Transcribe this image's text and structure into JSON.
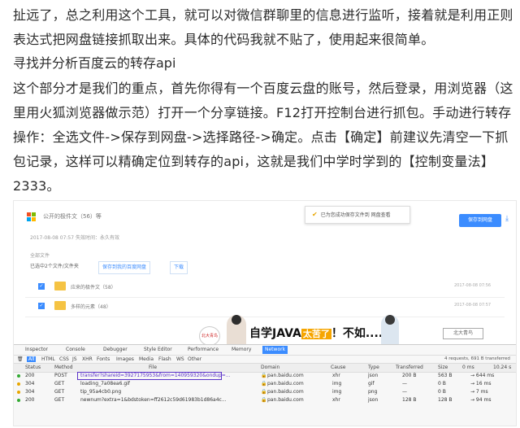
{
  "article": {
    "para1_line1": "扯远了，总之利用这个工具，就可以对微信群聊里的信息进行监听，接着就是利用正则",
    "para1_line2": "表达式把网盘链接抓取出来。具体的代码我就不贴了，使用起来很简单。",
    "heading": "寻找并分析百度云的转存api",
    "para2_line1": "这个部分才是我们的重点，首先你得有一个百度云盘的账号，然后登录，用浏览器（这",
    "para2_line2": "里用火狐浏览器做示范）打开一个分享链接。F12打开控制台进行抓包。手动进行转存",
    "para2_line3": "操作：全选文件->保存到网盘->选择路径->确定。点击【确定】前建议先清空一下抓",
    "para2_line4": "包记录，这样可以精确定位到转存的api，这就是我们中学时学到的【控制变量法】",
    "para2_line5": "2333。"
  },
  "screenshot": {
    "share_title": "公开的极件文（56）等",
    "meta": "2017-08-08 07:57   失效时间：永久有效",
    "toast": "已为您成功保存文件到 网盘查看",
    "save_button": "保存到网盘",
    "all_files": "全部文件",
    "toolbar_selected": "已选中2个文件/文件夹",
    "toolbar_save": "保存到我的百度网盘",
    "toolbar_download": "下载",
    "files": [
      {
        "name": "应来的极件文（58）",
        "date": "2017-08-08 07:56"
      },
      {
        "name": "多样的元素（48）",
        "date": "2017-08-08 07:57"
      }
    ],
    "ad": {
      "badge": "北大青鸟",
      "slogan_a": "自学JAVA",
      "slogan_hl": "太苦了",
      "slogan_b": "！不如......",
      "brand": "北大青鸟"
    },
    "devtools": {
      "tabs": [
        "Inspector",
        "Console",
        "Debugger",
        "Style Editor",
        "Performance",
        "Memory",
        "Network"
      ],
      "filters": [
        "All",
        "HTML",
        "CSS",
        "JS",
        "XHR",
        "Fonts",
        "Images",
        "Media",
        "Flash",
        "WS",
        "Other"
      ],
      "request_info": "4 requests, 691 B transferred",
      "headers": [
        "Status",
        "Method",
        "File",
        "Domain",
        "Cause",
        "Type",
        "Transferred",
        "Size",
        "0 ms",
        "10.24 s"
      ],
      "rows": [
        {
          "status": "200",
          "method": "POST",
          "file": "transfer?shareid=3927175953&from=140959320&ondup=...",
          "domain": "pan.baidu.com",
          "cause": "xhr",
          "type": "json",
          "transferred": "200 B",
          "size": "563 B",
          "timing": "→ 644 ms",
          "dot": "#33aa33"
        },
        {
          "status": "304",
          "method": "GET",
          "file": "loading_7a08ea6.gif",
          "domain": "pan.baidu.com",
          "cause": "img",
          "type": "gif",
          "transferred": "—",
          "size": "0 B",
          "timing": "→ 16 ms",
          "dot": "#e8a600"
        },
        {
          "status": "304",
          "method": "GET",
          "file": "tip_95a4cb0.png",
          "domain": "pan.baidu.com",
          "cause": "img",
          "type": "png",
          "transferred": "—",
          "size": "0 B",
          "timing": "→ 7 ms",
          "dot": "#e8a600"
        },
        {
          "status": "200",
          "method": "GET",
          "file": "newnum?extra=1&bdstoken=ff2612c59d61983b1d86a4c...",
          "domain": "pan.baidu.com",
          "cause": "xhr",
          "type": "json",
          "transferred": "128 B",
          "size": "128 B",
          "timing": "→ 94 ms",
          "dot": "#33aa33"
        }
      ]
    }
  }
}
